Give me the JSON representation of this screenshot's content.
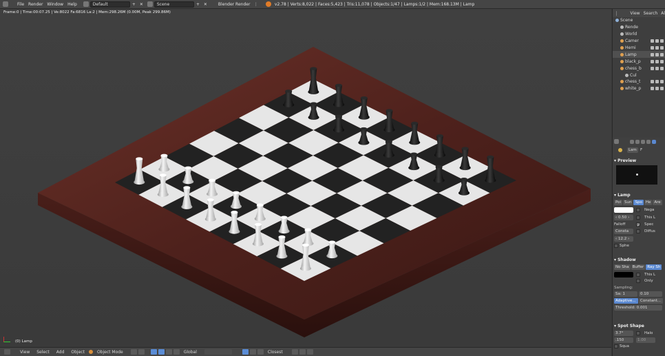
{
  "topbar": {
    "menus": [
      "File",
      "Render",
      "Window",
      "Help"
    ],
    "layout": "Default",
    "scene": "Scene",
    "engine": "Blender Render",
    "stats": "v2.78 | Verts:8,022 | Faces:5,423 | Tris:11,078 | Objects:1/47 | Lamps:1/2 | Mem:168.13M | Lamp"
  },
  "viewport": {
    "frame_info": "Frame:0 | Time:00:07.25 | Ve:8022 Fa:6816 La:2 | Mem:298.26M (0.00M, Peak 299.86M)",
    "object_name": "(0) Lamp"
  },
  "bottombar": {
    "items": [
      "View",
      "Select",
      "Add",
      "Object"
    ],
    "mode": "Object Mode",
    "orientation": "Global",
    "snap": "Closest"
  },
  "outliner": {
    "header": [
      "View",
      "Search",
      "Al"
    ],
    "rows": [
      {
        "label": "Scene",
        "depth": 0,
        "color": "#8fb1d9"
      },
      {
        "label": "Rende",
        "depth": 1,
        "color": "#bbbbbb"
      },
      {
        "label": "World",
        "depth": 1,
        "color": "#bbbbbb"
      },
      {
        "label": "Camer",
        "depth": 1,
        "color": "#e0a050"
      },
      {
        "label": "Hemi",
        "depth": 1,
        "color": "#e0a050"
      },
      {
        "label": "Lamp",
        "depth": 1,
        "color": "#e0a050",
        "selected": true
      },
      {
        "label": "black_p",
        "depth": 1,
        "color": "#e0a050"
      },
      {
        "label": "chess_b",
        "depth": 1,
        "color": "#e0a050"
      },
      {
        "label": "Cul",
        "depth": 2,
        "color": "#bbbbbb"
      },
      {
        "label": "chess_t",
        "depth": 1,
        "color": "#e0a050"
      },
      {
        "label": "white_p",
        "depth": 1,
        "color": "#e0a050"
      }
    ]
  },
  "properties": {
    "datablock": "Lam",
    "datablock_suffix": "F",
    "preview_title": "Preview",
    "lamp_title": "Lamp",
    "lamp_types": [
      "Poi",
      "Sun",
      "Spo",
      "He",
      "Are"
    ],
    "lamp_types_active": 2,
    "energy": "0.50",
    "falloff_label": "Falloff",
    "falloff_value": "Consta",
    "distance": "12.2",
    "sphere_label": "Sphe",
    "opts": [
      "Nega",
      "This L",
      "Spec",
      "Diffus"
    ],
    "shadow_title": "Shadow",
    "shadow_types": [
      "No Sha",
      "Buffer",
      "Ray Sh"
    ],
    "shadow_opts": [
      "This L",
      "Only"
    ],
    "sampling_label": "Sampling:",
    "samples": "Sa: 1",
    "soft": "0.10",
    "adaptive": "Adaptive...",
    "constant": "Constant...",
    "threshold": "Threshold:  0.001",
    "spot_title": "Spot Shape",
    "spot_size": "3.7°",
    "spot_blend": ".150",
    "spot_halo": "Halo",
    "spot_halo_step": "1.00",
    "spot_square": "Squa"
  },
  "colors": {
    "accent": "#5a88d0",
    "board_wood": "#5e2a24",
    "dark_square": "#222222",
    "light_square": "#e6e6e6"
  }
}
